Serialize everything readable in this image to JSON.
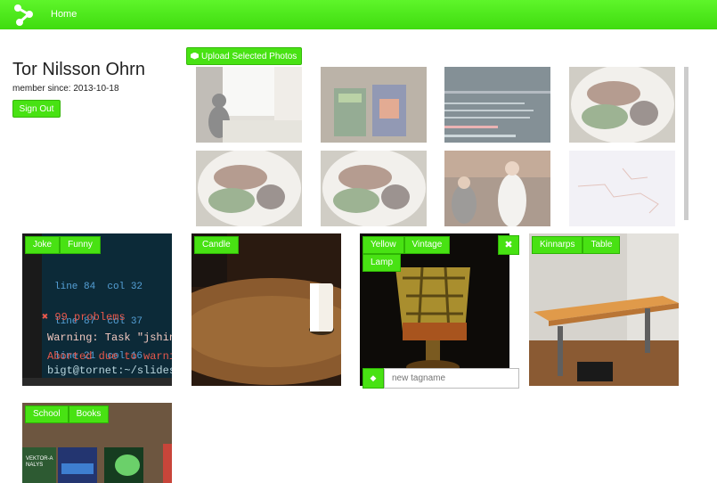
{
  "nav": {
    "home": "Home"
  },
  "profile": {
    "name": "Tor Nilsson Ohrn",
    "member_since": "member since: 2013-10-18",
    "sign_out": "Sign Out"
  },
  "upload": {
    "label": "Upload Selected Photos"
  },
  "thumbs": [
    "cat by window",
    "books",
    "terminal",
    "food plate",
    "food plate",
    "food plate",
    "people",
    "sketch"
  ],
  "cards": [
    {
      "tags": [
        "Joke",
        "Funny"
      ]
    },
    {
      "tags": [
        "Candle"
      ]
    },
    {
      "tags": [
        "Yellow",
        "Vintage",
        "Lamp"
      ],
      "close": "✖",
      "input_placeholder": "new tagname"
    },
    {
      "tags": [
        "Kinnarps",
        "Table"
      ]
    },
    {
      "tags": [
        "School",
        "Books"
      ]
    }
  ],
  "terminal": {
    "lines": [
      "line 84  col 32",
      "line 87  col 37",
      "line 21  col 16"
    ],
    "problems": "✖ 99 problems",
    "warning": "Warning: Task \"jshint:",
    "aborted": "Aborted due to warning",
    "prompt": "bigt@tornet:~/slidesi"
  },
  "books": [
    "VEKTOR-ANALYS"
  ]
}
